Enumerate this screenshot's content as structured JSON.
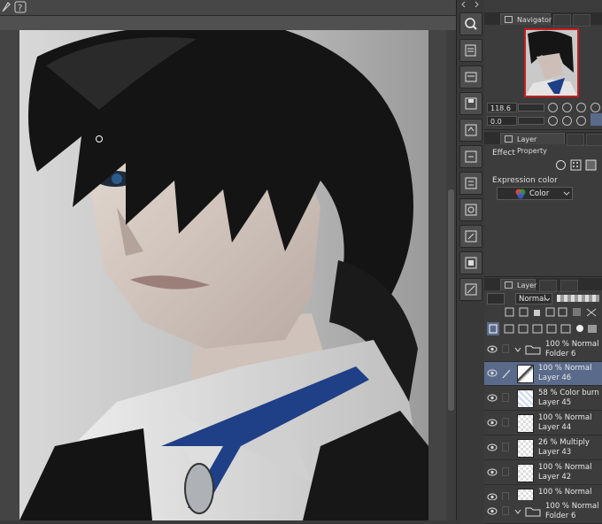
{
  "navigator": {
    "tab_label": "Navigator",
    "zoom": "118.6",
    "rotation": "0.0"
  },
  "layer_property": {
    "tab_label": "Layer Property",
    "effect_label": "Effect",
    "expression_color_label": "Expression color",
    "expression_color_value": "Color"
  },
  "layer_panel": {
    "tab_label": "Layer",
    "blend_mode": "Normal",
    "layers": [
      {
        "line1": "100 % Normal",
        "line2": "Folder 6",
        "type": "folder",
        "selected": false
      },
      {
        "line1": "100 % Normal",
        "line2": "Layer 46",
        "type": "layer",
        "selected": true
      },
      {
        "line1": "58 % Color burn",
        "line2": "Layer 45",
        "type": "layer",
        "selected": false
      },
      {
        "line1": "100 % Normal",
        "line2": "Layer 44",
        "type": "layer",
        "selected": false
      },
      {
        "line1": "26 % Multiply",
        "line2": "Layer 43",
        "type": "layer",
        "selected": false
      },
      {
        "line1": "100 % Normal",
        "line2": "Layer 42",
        "type": "layer",
        "selected": false
      },
      {
        "line1": "100 % Normal",
        "line2": "",
        "type": "layer",
        "selected": false
      },
      {
        "line1": "100 % Normal",
        "line2": "Folder 6",
        "type": "folder",
        "selected": false
      }
    ]
  },
  "colors": {
    "selection_highlight": "#5a6a8a",
    "navigator_frame": "#c81e1e",
    "tie_blue": "#1f3f86"
  }
}
